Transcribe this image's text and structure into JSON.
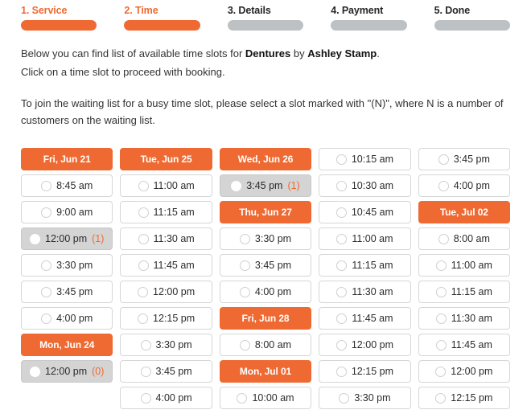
{
  "theme": {
    "accent": "#ee6a32",
    "inactive_bar": "#bdc1c4",
    "waiting_bg": "#d4d4d4"
  },
  "steps": [
    {
      "label": "1. Service",
      "state": "active"
    },
    {
      "label": "2. Time",
      "state": "active"
    },
    {
      "label": "3. Details",
      "state": "inactive"
    },
    {
      "label": "4. Payment",
      "state": "inactive"
    },
    {
      "label": "5. Done",
      "state": "inactive"
    }
  ],
  "intro": {
    "line1_pre": "Below you can find list of available time slots for ",
    "service": "Dentures",
    "line1_mid": " by ",
    "provider": "Ashley Stamp",
    "line1_post": ".",
    "line2": "Click on a time slot to proceed with booking.",
    "line3": "To join the waiting list for a busy time slot, please select a slot marked with \"(N)\", where N is a number of customers on the waiting list."
  },
  "columns": [
    {
      "items": [
        {
          "kind": "day",
          "label": "Fri, Jun 21"
        },
        {
          "kind": "slot",
          "time": "8:45 am"
        },
        {
          "kind": "slot",
          "time": "9:00 am"
        },
        {
          "kind": "slot",
          "time": "12:00 pm",
          "waiting": "(1)"
        },
        {
          "kind": "slot",
          "time": "3:30 pm"
        },
        {
          "kind": "slot",
          "time": "3:45 pm"
        },
        {
          "kind": "slot",
          "time": "4:00 pm"
        },
        {
          "kind": "day",
          "label": "Mon, Jun 24"
        },
        {
          "kind": "slot",
          "time": "12:00 pm",
          "waiting": "(0)"
        }
      ]
    },
    {
      "items": [
        {
          "kind": "day",
          "label": "Tue, Jun 25"
        },
        {
          "kind": "slot",
          "time": "11:00 am"
        },
        {
          "kind": "slot",
          "time": "11:15 am"
        },
        {
          "kind": "slot",
          "time": "11:30 am"
        },
        {
          "kind": "slot",
          "time": "11:45 am"
        },
        {
          "kind": "slot",
          "time": "12:00 pm"
        },
        {
          "kind": "slot",
          "time": "12:15 pm"
        },
        {
          "kind": "slot",
          "time": "3:30 pm"
        },
        {
          "kind": "slot",
          "time": "3:45 pm"
        },
        {
          "kind": "slot",
          "time": "4:00 pm"
        }
      ]
    },
    {
      "items": [
        {
          "kind": "day",
          "label": "Wed, Jun 26"
        },
        {
          "kind": "slot",
          "time": "3:45 pm",
          "waiting": "(1)"
        },
        {
          "kind": "day",
          "label": "Thu, Jun 27"
        },
        {
          "kind": "slot",
          "time": "3:30 pm"
        },
        {
          "kind": "slot",
          "time": "3:45 pm"
        },
        {
          "kind": "slot",
          "time": "4:00 pm"
        },
        {
          "kind": "day",
          "label": "Fri, Jun 28"
        },
        {
          "kind": "slot",
          "time": "8:00 am"
        },
        {
          "kind": "day",
          "label": "Mon, Jul 01"
        },
        {
          "kind": "slot",
          "time": "10:00 am"
        }
      ]
    },
    {
      "items": [
        {
          "kind": "slot",
          "time": "10:15 am"
        },
        {
          "kind": "slot",
          "time": "10:30 am"
        },
        {
          "kind": "slot",
          "time": "10:45 am"
        },
        {
          "kind": "slot",
          "time": "11:00 am"
        },
        {
          "kind": "slot",
          "time": "11:15 am"
        },
        {
          "kind": "slot",
          "time": "11:30 am"
        },
        {
          "kind": "slot",
          "time": "11:45 am"
        },
        {
          "kind": "slot",
          "time": "12:00 pm"
        },
        {
          "kind": "slot",
          "time": "12:15 pm"
        },
        {
          "kind": "slot",
          "time": "3:30 pm"
        }
      ]
    },
    {
      "items": [
        {
          "kind": "slot",
          "time": "3:45 pm"
        },
        {
          "kind": "slot",
          "time": "4:00 pm"
        },
        {
          "kind": "day",
          "label": "Tue, Jul 02"
        },
        {
          "kind": "slot",
          "time": "8:00 am"
        },
        {
          "kind": "slot",
          "time": "11:00 am"
        },
        {
          "kind": "slot",
          "time": "11:15 am"
        },
        {
          "kind": "slot",
          "time": "11:30 am"
        },
        {
          "kind": "slot",
          "time": "11:45 am"
        },
        {
          "kind": "slot",
          "time": "12:00 pm"
        },
        {
          "kind": "slot",
          "time": "12:15 pm"
        }
      ]
    }
  ]
}
